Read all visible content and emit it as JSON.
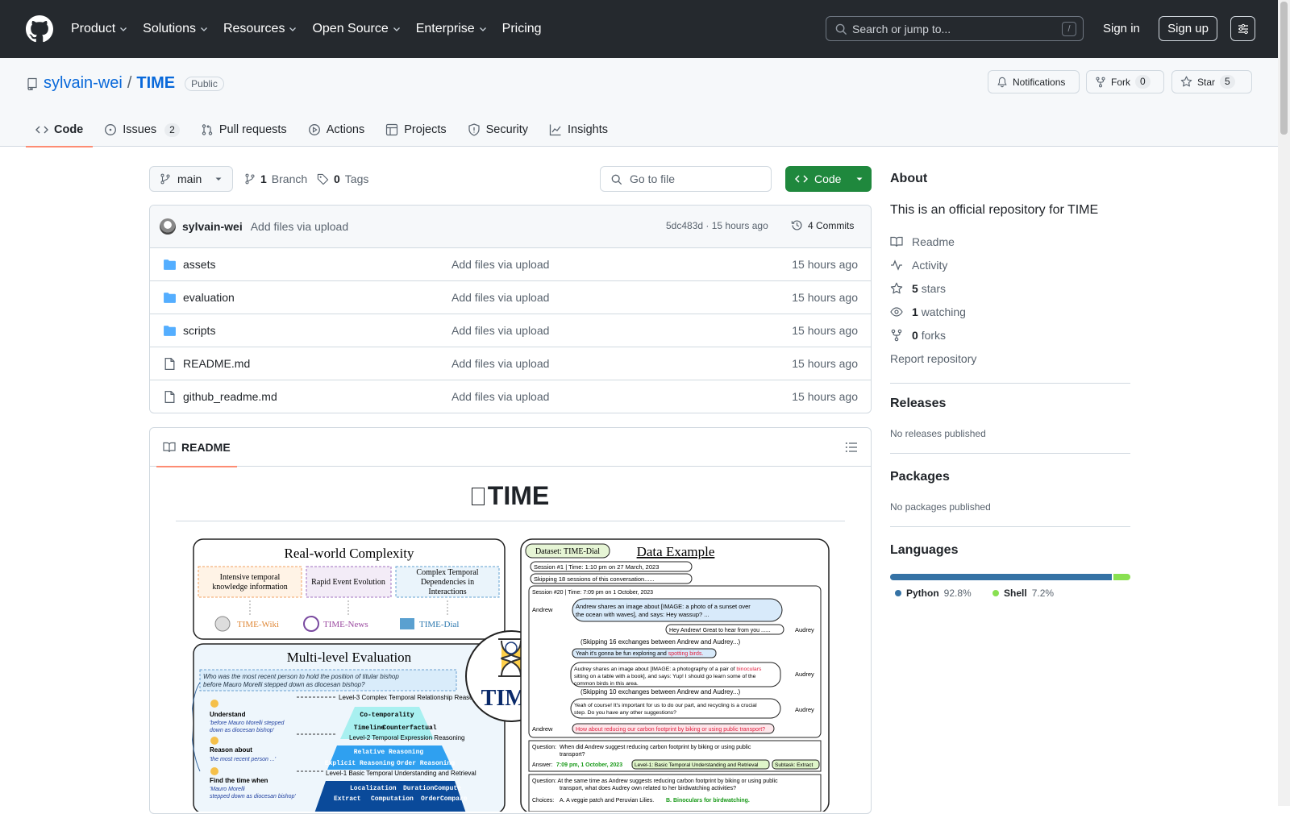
{
  "header": {
    "nav": [
      {
        "label": "Product",
        "dropdown": true
      },
      {
        "label": "Solutions",
        "dropdown": true
      },
      {
        "label": "Resources",
        "dropdown": true
      },
      {
        "label": "Open Source",
        "dropdown": true
      },
      {
        "label": "Enterprise",
        "dropdown": true
      },
      {
        "label": "Pricing",
        "dropdown": false
      }
    ],
    "search_placeholder": "Search or jump to...",
    "search_shortcut": "/",
    "signin": "Sign in",
    "signup": "Sign up"
  },
  "repo": {
    "owner": "sylvain-wei",
    "separator": "/",
    "name": "TIME",
    "visibility": "Public",
    "notifications": "Notifications",
    "fork_label": "Fork",
    "fork_count": "0",
    "star_label": "Star",
    "star_count": "5"
  },
  "tabs": [
    {
      "label": "Code",
      "icon": "code-icon",
      "active": true
    },
    {
      "label": "Issues",
      "icon": "issue-icon",
      "count": "2"
    },
    {
      "label": "Pull requests",
      "icon": "pull-request-icon"
    },
    {
      "label": "Actions",
      "icon": "play-icon"
    },
    {
      "label": "Projects",
      "icon": "table-icon"
    },
    {
      "label": "Security",
      "icon": "shield-icon"
    },
    {
      "label": "Insights",
      "icon": "graph-icon"
    }
  ],
  "toolbar": {
    "branch": "main",
    "branches_count": "1",
    "branches_label": "Branch",
    "tags_count": "0",
    "tags_label": "Tags",
    "goto_placeholder": "Go to file",
    "code_label": "Code"
  },
  "commit": {
    "user": "sylvain-wei",
    "message": "Add files via upload",
    "hash": "5dc483d · 15 hours ago",
    "commits_label": "4 Commits"
  },
  "files": [
    {
      "name": "assets",
      "type": "folder",
      "message": "Add files via upload",
      "time": "15 hours ago"
    },
    {
      "name": "evaluation",
      "type": "folder",
      "message": "Add files via upload",
      "time": "15 hours ago"
    },
    {
      "name": "scripts",
      "type": "folder",
      "message": "Add files via upload",
      "time": "15 hours ago"
    },
    {
      "name": "README.md",
      "type": "file",
      "message": "Add files via upload",
      "time": "15 hours ago"
    },
    {
      "name": "github_readme.md",
      "type": "file",
      "message": "Add files via upload",
      "time": "15 hours ago"
    }
  ],
  "readme": {
    "tab_label": "README",
    "title": "TIME",
    "figure": {
      "left_top_title": "Real-world Complexity",
      "boxes": [
        "Intensive temporal knowledge information",
        "Rapid Event Evolution",
        "Complex Temporal Dependencies in Interactions"
      ],
      "datasets": [
        "TIME-Wiki",
        "TIME-News",
        "TIME-Dial"
      ],
      "left_bottom_title": "Multi-level Evaluation",
      "question": "Who was the most recent person to hold the position of titular bishop before Mauro Morelli stepped down as diocesan bishop?",
      "levels": [
        "Level-3 Complex Temporal Relationship Reasoning",
        "Co-temporality",
        "Timeline",
        "Counterfactual",
        "Level-2 Temporal Expression Reasoning",
        "Relative Reasoning",
        "Explicit Reasoning",
        "Order Reasoning",
        "Level-1 Basic Temporal Understanding and Retrieval",
        "Localization",
        "DurationCompute",
        "Extract",
        "Computation",
        "OrderCompare"
      ],
      "steps": [
        "Understand",
        "'before Mauro Morelli stepped down as diocesan bishop'",
        "Reason about",
        "'the most recent person ...'",
        "Find the time when",
        "'Mauro Morelli stepped down as diocesan bishop'"
      ],
      "badge": "TIME",
      "dataset_tag": "Dataset: TIME-Dial",
      "right_title": "Data Example",
      "session1": "Session #1  |  Time: 1:10 pm on 27 March, 2023",
      "skip18": "Skipping 18 sessions of this conversation......",
      "session20": "Session #20 | Time: 7:09 pm on 1 October, 2023",
      "chat": [
        {
          "who": "Andrew",
          "text": "Andrew shares an image about [IMAGE: a photo of a sunset over the ocean with waves], and says: Hey wassup? ..."
        },
        {
          "who": "Audrey",
          "text": "Hey Andrew! Great to hear from you ......"
        },
        {
          "who": "",
          "text": "(Skipping 16 exchanges between Andrew and Audrey...)"
        },
        {
          "who": "",
          "text": "Yeah it's gonna be fun exploring and spotting birds."
        },
        {
          "who": "Audrey",
          "text": "Audrey shares an image about [IMAGE: a photography of a pair of binoculars sitting on a table with a book], and says: Yup! I should go learn some of the common birds in this area."
        },
        {
          "who": "",
          "text": "(Skipping 10 exchanges between Andrew and Audrey...)"
        },
        {
          "who": "Audrey",
          "text": "Yeah of course! It's important for us to do our part, and recycling is a crucial step. Do you have any other suggestions?"
        },
        {
          "who": "Andrew",
          "text": "How about reducing our carbon footprint by biking or using public transport?"
        }
      ],
      "q1_label": "Question:",
      "q1": "When did Andrew suggest reducing carbon footprint by biking or using public transport?",
      "a1_label": "Answer:",
      "a1": "7:09 pm, 1 October, 2023",
      "a1_tag1": "Level-1: Basic Temporal Understanding and Retrieval",
      "a1_tag2": "Subtask: Extract",
      "q2": "At the same time as Andrew suggests reducing carbon footprint by biking or using public transport, what does Audrey own related to her birdwatching activities?",
      "choices_label": "Choices:",
      "choices": "A. A veggie patch and Peruvian Lilies.",
      "choice_b": "B. Binoculars for birdwatching."
    }
  },
  "about": {
    "heading": "About",
    "description": "This is an official repository for TIME",
    "readme": "Readme",
    "activity": "Activity",
    "stars_count": "5",
    "stars_label": "stars",
    "watching_count": "1",
    "watching_label": "watching",
    "forks_count": "0",
    "forks_label": "forks",
    "report": "Report repository"
  },
  "releases": {
    "heading": "Releases",
    "note": "No releases published"
  },
  "packages": {
    "heading": "Packages",
    "note": "No packages published"
  },
  "languages": {
    "heading": "Languages",
    "items": [
      {
        "name": "Python",
        "pct": "92.8%",
        "value": 92.8,
        "color": "#3572A5"
      },
      {
        "name": "Shell",
        "pct": "7.2%",
        "value": 7.2,
        "color": "#89e051"
      }
    ]
  }
}
